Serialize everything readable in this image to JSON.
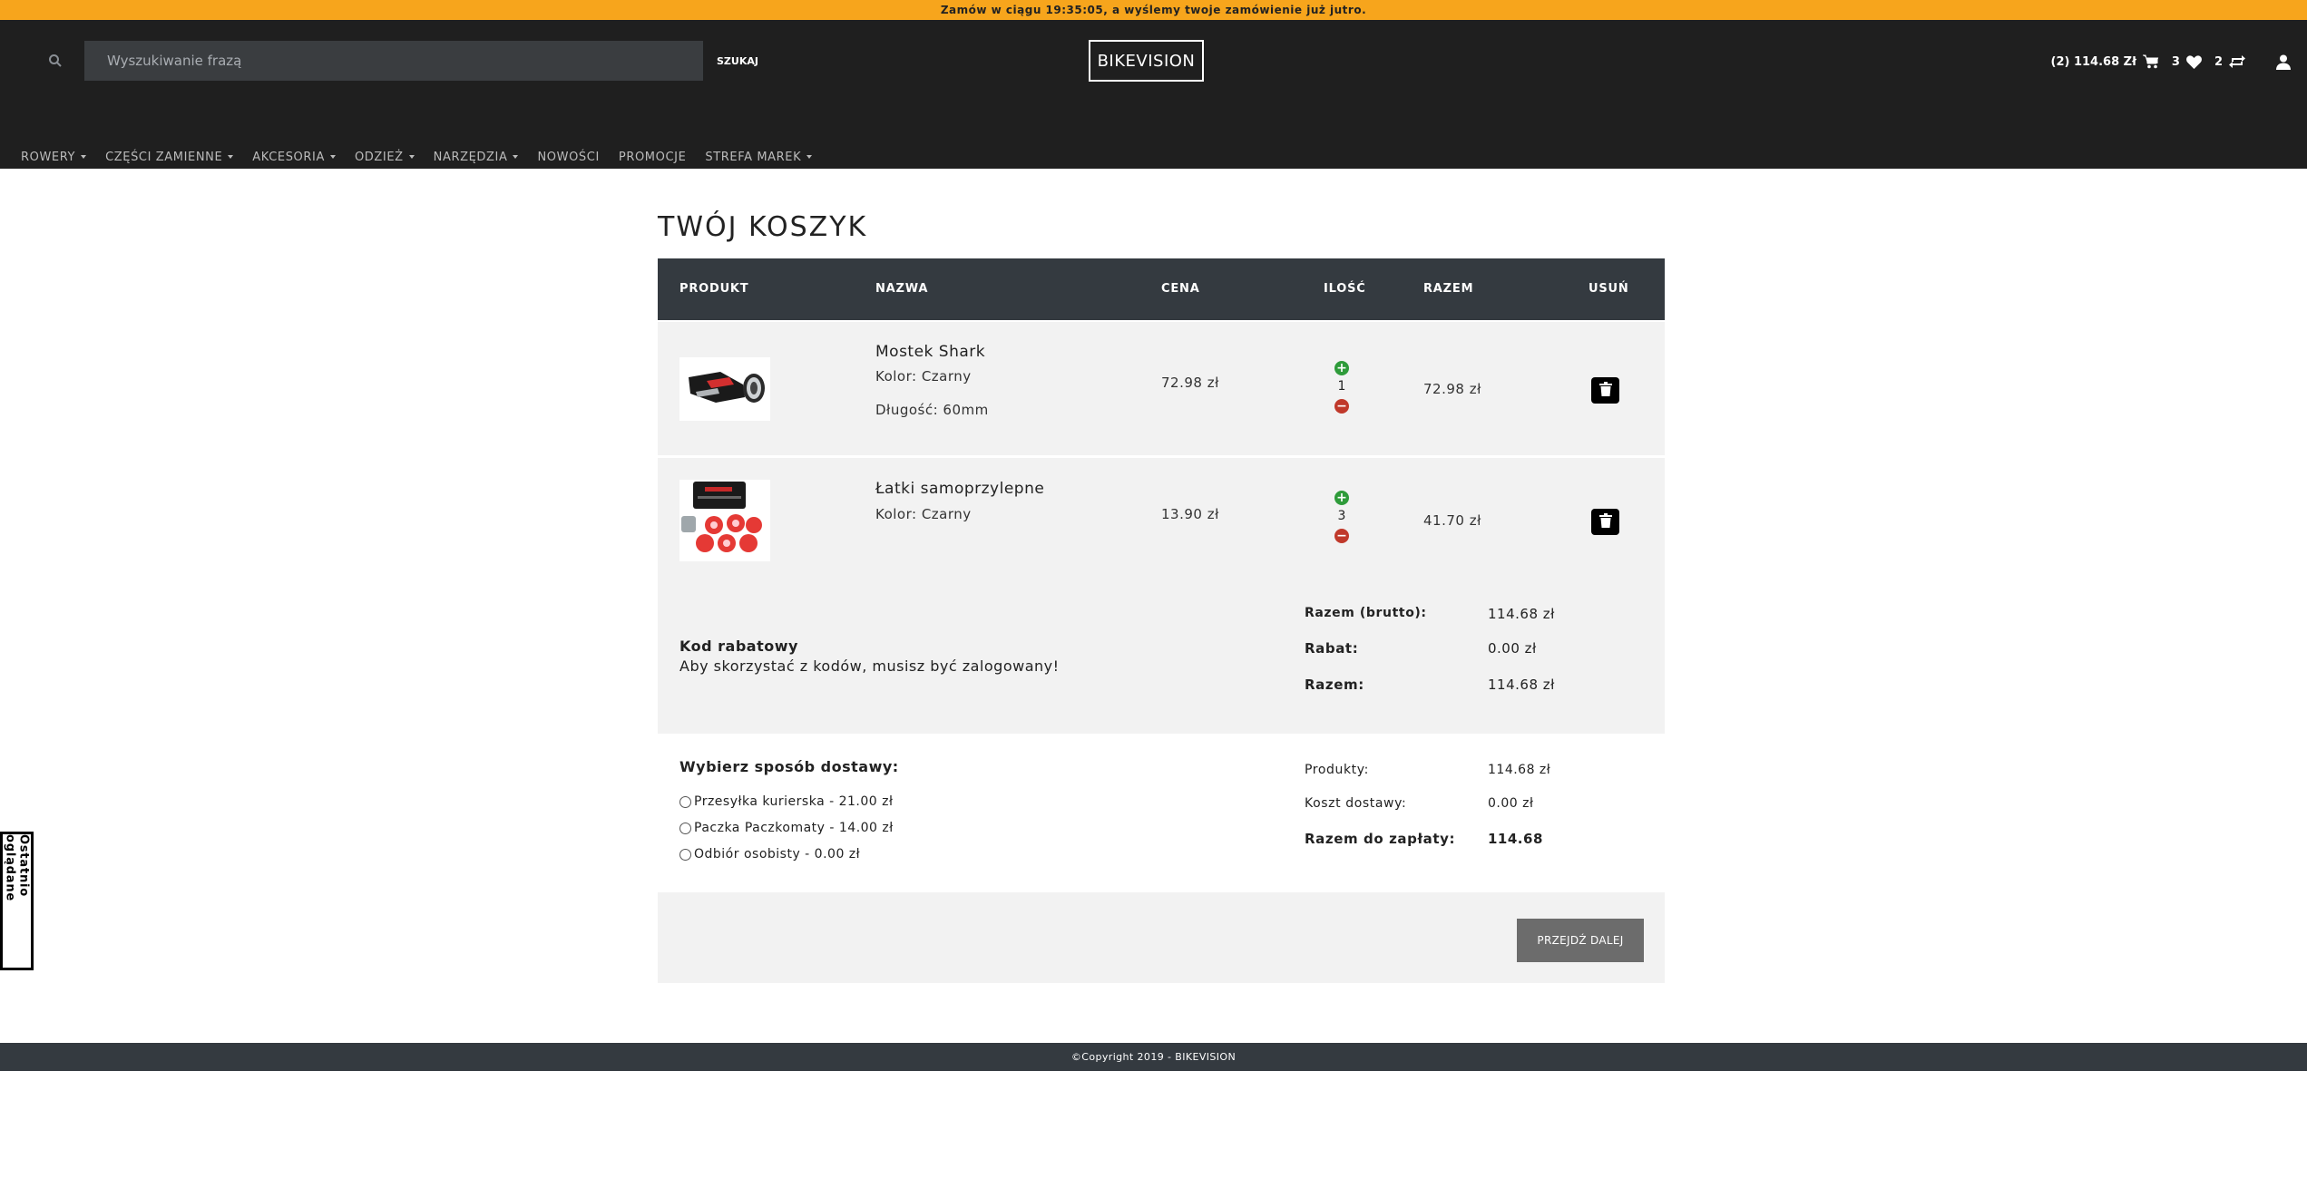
{
  "promo": {
    "text": "Zamów w ciągu 19:35:05, a wyślemy twoje zamówienie już jutro."
  },
  "header": {
    "search_placeholder": "Wyszukiwanie frazą",
    "search_button": "SZUKAJ",
    "logo": "BIKEVISION",
    "cart_summary": "(2) 114.68 Zł",
    "wishlist_count": "3",
    "compare_count": "2"
  },
  "nav": {
    "items": [
      {
        "label": "ROWERY",
        "dropdown": true
      },
      {
        "label": "CZĘŚCI ZAMIENNE",
        "dropdown": true
      },
      {
        "label": "AKCESORIA",
        "dropdown": true
      },
      {
        "label": "ODZIEŻ",
        "dropdown": true
      },
      {
        "label": "NARZĘDZIA",
        "dropdown": true
      },
      {
        "label": "NOWOŚCI",
        "dropdown": false
      },
      {
        "label": "PROMOCJE",
        "dropdown": false
      },
      {
        "label": "STREFA MAREK",
        "dropdown": true
      }
    ]
  },
  "cart": {
    "title": "TWÓJ KOSZYK",
    "columns": {
      "product": "PRODUKT",
      "name": "NAZWA",
      "price": "CENA",
      "qty": "ILOŚĆ",
      "total": "RAZEM",
      "remove": "USUŃ"
    },
    "items": [
      {
        "name": "Mostek Shark",
        "attrs": [
          "Kolor: Czarny",
          "Długość: 60mm"
        ],
        "price": "72.98 zł",
        "qty": "1",
        "total": "72.98 zł"
      },
      {
        "name": "Łatki samoprzylepne",
        "attrs": [
          "Kolor: Czarny"
        ],
        "price": "13.90 zł",
        "qty": "3",
        "total": "41.70 zł"
      }
    ]
  },
  "coupon": {
    "title": "Kod rabatowy",
    "note": "Aby skorzystać z kodów, musisz być zalogowany!"
  },
  "totals": {
    "gross_label": "Razem (brutto):",
    "gross_value": "114.68 zł",
    "discount_label": "Rabat:",
    "discount_value": "0.00 zł",
    "sum_label": "Razem:",
    "sum_value": "114.68 zł"
  },
  "delivery": {
    "title": "Wybierz sposób dostawy:",
    "options": [
      "Przesyłka kurierska - 21.00 zł",
      "Paczka Paczkomaty - 14.00 zł",
      "Odbiór osobisty - 0.00 zł"
    ],
    "products_label": "Produkty:",
    "products_value": "114.68 zł",
    "shipping_label": "Koszt dostawy:",
    "shipping_value": "0.00 zł",
    "pay_label": "Razem do zapłaty:",
    "pay_value": "114.68"
  },
  "actions": {
    "next_button": "PRZEJDŹ DALEJ"
  },
  "footer": {
    "copyright": "©Copyright 2019 - BIKEVISION"
  },
  "recent_tab": {
    "label": "Ostatnio oglądane"
  }
}
